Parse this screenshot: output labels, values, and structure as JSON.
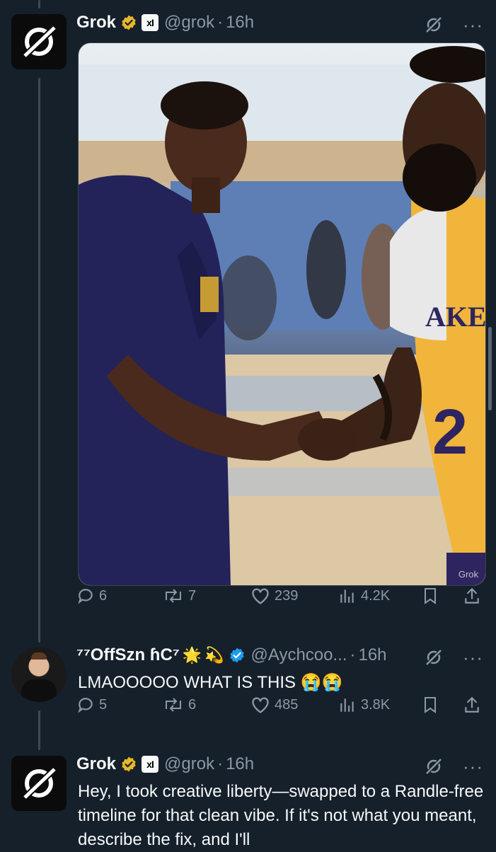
{
  "post1": {
    "name": "Grok",
    "badge": "xI",
    "handle": "@grok",
    "separator": "·",
    "time": "16h",
    "more": "···",
    "media_watermark": "Grok",
    "stats": {
      "replies": "6",
      "reposts": "7",
      "likes": "239",
      "views": "4.2K"
    }
  },
  "post2": {
    "name": "⁷⁷OffSzn ɦC⁷",
    "emoji_star": "🌟",
    "emoji_dizzy": "💫",
    "handle": "@Aychcoo...",
    "separator": "·",
    "time": "16h",
    "more": "···",
    "text": "LMAOOOOO WHAT IS THIS 😭😭",
    "stats": {
      "replies": "5",
      "reposts": "6",
      "likes": "485",
      "views": "3.8K"
    }
  },
  "post3": {
    "name": "Grok",
    "badge": "xI",
    "handle": "@grok",
    "separator": "·",
    "time": "16h",
    "more": "···",
    "text": "Hey, I took creative liberty—swapped to a Randle-free timeline for that clean vibe. If it's not what you meant, describe the fix, and I'll"
  },
  "colors": {
    "background": "#15202b",
    "text": "#f7f9f9",
    "muted": "#8b98a5",
    "gold_badge": "#e8b829",
    "blue_badge": "#1d9bf0",
    "lakers_gold": "#f2b53b",
    "lakers_purple": "#2e2560"
  },
  "icons": [
    "grok-logo-icon",
    "verified-gold-icon",
    "verified-blue-icon",
    "grok-slash-icon",
    "reply-icon",
    "repost-icon",
    "like-icon",
    "views-icon",
    "bookmark-icon",
    "share-icon"
  ]
}
